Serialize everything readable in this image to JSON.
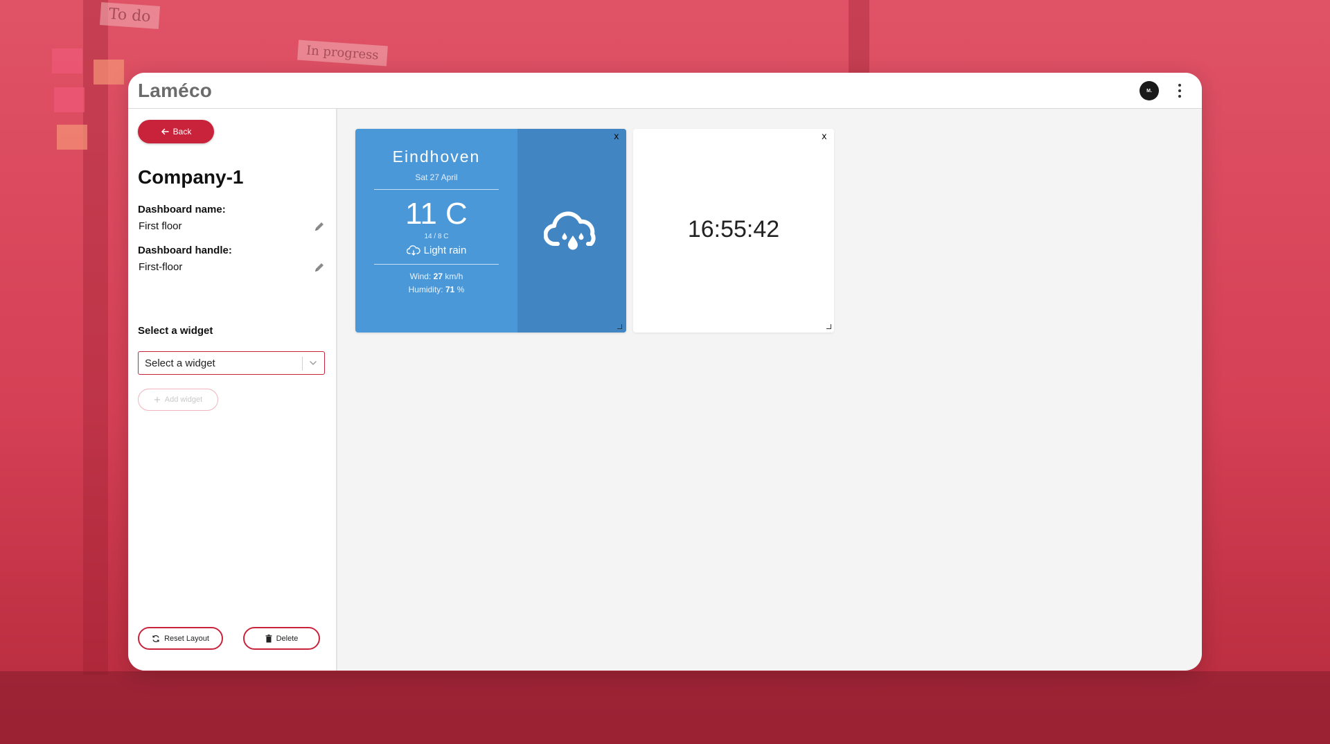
{
  "app": {
    "logo": "Laméco",
    "avatar_initials": "M."
  },
  "sidebar": {
    "back_label": "Back",
    "company_title": "Company-1",
    "dashboard_name_label": "Dashboard name:",
    "dashboard_name_value": "First floor",
    "dashboard_handle_label": "Dashboard handle:",
    "dashboard_handle_value": "First-floor",
    "select_widget_label": "Select a widget",
    "select_widget_value": "Select a widget",
    "add_widget_label": "Add widget",
    "reset_layout_label": "Reset Layout",
    "delete_label": "Delete"
  },
  "widgets": {
    "weather": {
      "city": "Eindhoven",
      "date": "Sat 27 April",
      "temperature": "11 C",
      "range": "14 / 8 C",
      "description": "Light rain",
      "wind_label": "Wind:",
      "wind_value": "27",
      "wind_unit": "km/h",
      "humidity_label": "Humidity:",
      "humidity_value": "71",
      "humidity_unit": "%",
      "close_label": "x"
    },
    "clock": {
      "time": "16:55:42",
      "close_label": "x"
    }
  },
  "background": {
    "sheet_todo": "To do",
    "sheet_inprogress": "In progress"
  },
  "colors": {
    "accent": "#c8233a",
    "weather_left": "#4b98d8",
    "weather_right": "#4186c3",
    "canvas": "#f4f4f4"
  },
  "icons": {
    "back": "arrow-left-icon",
    "edit": "pencil-icon",
    "chevron": "chevron-down-icon",
    "add": "plus-icon",
    "reset": "refresh-icon",
    "delete": "trash-icon",
    "weather_small": "cloud-rain-icon",
    "weather_big": "cloud-rain-drop-icon",
    "menu": "more-vertical-icon"
  }
}
